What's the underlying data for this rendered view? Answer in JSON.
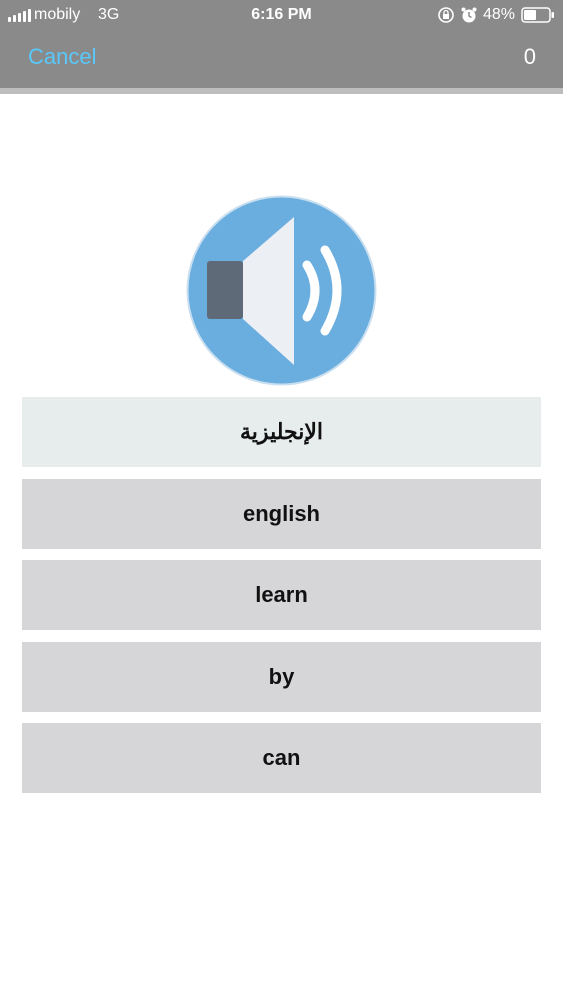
{
  "status_bar": {
    "carrier": "mobily",
    "network": "3G",
    "time": "6:16 PM",
    "battery_percent": "48%",
    "icons": [
      "signal-icon",
      "orientation-lock-icon",
      "alarm-icon",
      "battery-icon"
    ]
  },
  "nav": {
    "cancel_label": "Cancel",
    "score": "0"
  },
  "audio": {
    "icon": "speaker-icon",
    "colors": {
      "circle": "#6aaee0",
      "cone": "#eceff4",
      "box": "#5e6a78",
      "waves": "#ffffff"
    }
  },
  "question_word": "الإنجليزية",
  "options": [
    "english",
    "learn",
    "by",
    "can"
  ],
  "colors": {
    "topbar": "#8a8a8a",
    "accent": "#5ac8fa",
    "question_bg": "#e7ecec",
    "option_bg": "#d6d6d9"
  }
}
